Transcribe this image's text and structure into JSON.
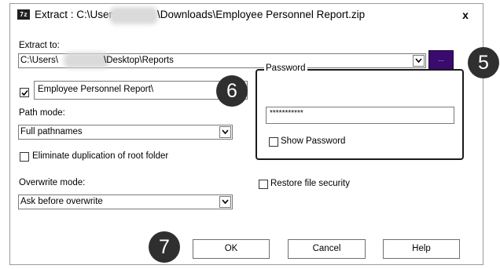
{
  "window": {
    "app_icon_text": "7z",
    "title_prefix": "Extract : C:\\Users\\",
    "title_suffix": "\\Downloads\\Employee Personnel Report.zip",
    "close_label": "x"
  },
  "extract_to": {
    "label": "Extract to:",
    "path_prefix": "C:\\Users\\",
    "path_suffix": "\\Desktop\\Reports",
    "browse_label": "..."
  },
  "folder": {
    "checked": true,
    "name": "Employee Personnel Report\\"
  },
  "path_mode": {
    "label": "Path mode:",
    "value": "Full pathnames"
  },
  "eliminate_duplication": {
    "label": "Eliminate duplication of root folder",
    "checked": false
  },
  "overwrite_mode": {
    "label": "Overwrite mode:",
    "value": "Ask before overwrite"
  },
  "password": {
    "legend": "Password",
    "masked_value": "***********",
    "show_password_label": "Show Password",
    "show_password_checked": false
  },
  "restore_security": {
    "label": "Restore file security",
    "checked": false
  },
  "buttons": {
    "ok": "OK",
    "cancel": "Cancel",
    "help": "Help"
  },
  "callouts": {
    "five": "5",
    "six": "6",
    "seven": "7"
  }
}
